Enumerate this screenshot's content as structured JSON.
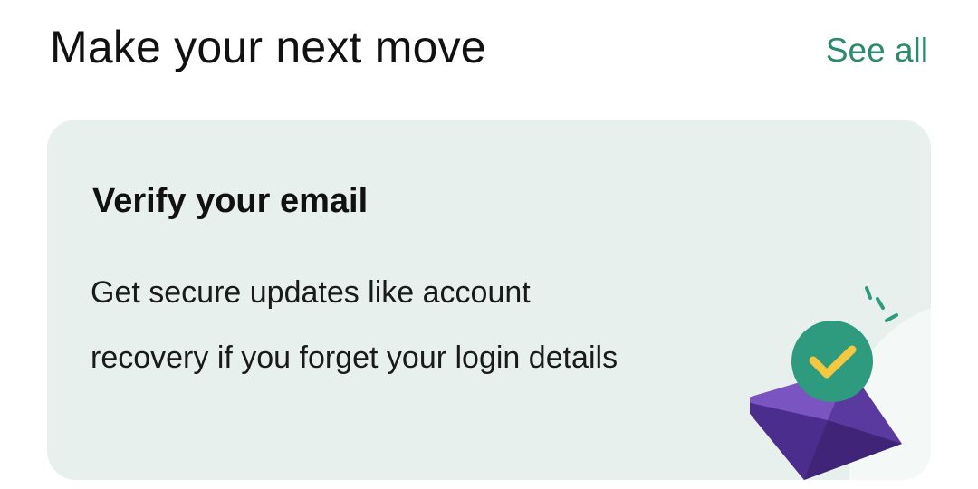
{
  "section": {
    "title": "Make your next move",
    "see_all_label": "See all"
  },
  "card": {
    "title": "Verify your email",
    "description_line1": "Get secure updates like account",
    "description_line2": "recovery if you forget your login details",
    "illustration_icon": "envelope-checkmark-icon"
  },
  "colors": {
    "accent": "#2a8a6a",
    "card_background": "#e7f0ec",
    "envelope": "#5b3aa0",
    "check_circle": "#2e9a7e",
    "check_mark": "#f5c842"
  }
}
